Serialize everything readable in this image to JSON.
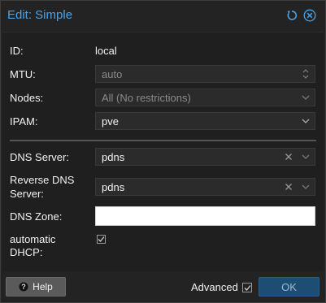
{
  "dialog": {
    "title": "Edit: Simple"
  },
  "form": {
    "id": {
      "label": "ID:",
      "value": "local"
    },
    "mtu": {
      "label": "MTU:",
      "value": "auto"
    },
    "nodes": {
      "label": "Nodes:",
      "value": "All (No restrictions)"
    },
    "ipam": {
      "label": "IPAM:",
      "value": "pve"
    },
    "dns_server": {
      "label": "DNS Server:",
      "value": "pdns"
    },
    "reverse_dns": {
      "label_line1": "Reverse DNS",
      "label_line2": "Server:",
      "value": "pdns"
    },
    "dns_zone": {
      "label": "DNS Zone:",
      "value": ""
    },
    "auto_dhcp": {
      "label_line1": "automatic",
      "label_line2": "DHCP:",
      "checked": true
    }
  },
  "footer": {
    "help_label": "Help",
    "advanced_label": "Advanced",
    "advanced_checked": true,
    "ok_label": "OK"
  },
  "colors": {
    "accent": "#4aa3e6",
    "ok_bg": "#1e4d73",
    "panel": "#1f1f1f"
  }
}
